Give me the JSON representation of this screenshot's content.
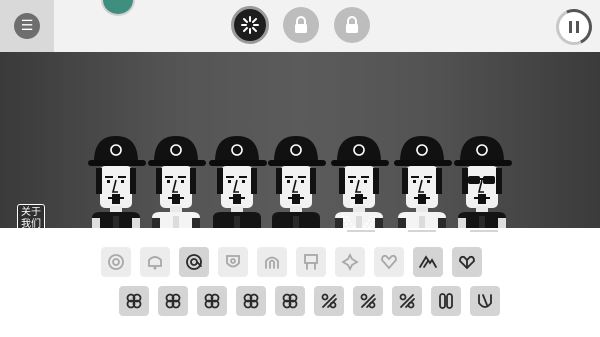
{
  "topbar": {
    "menu_icon": "☰",
    "modes": [
      {
        "name": "mode-1",
        "state": "active",
        "icon": "sparkle-icon"
      },
      {
        "name": "mode-2",
        "state": "locked",
        "icon": "lock-icon"
      },
      {
        "name": "mode-3",
        "state": "locked",
        "icon": "lock-icon"
      }
    ],
    "pause_icon": "pause-icon"
  },
  "stage": {
    "about_line1": "关于",
    "about_line2": "我们",
    "performers": [
      {
        "cap_icon": "swirl",
        "shirt": "vest"
      },
      {
        "cap_icon": "spiral",
        "shirt": "jacket"
      },
      {
        "cap_icon": "dots",
        "shirt": "sleeveless"
      },
      {
        "cap_icon": "loop",
        "shirt": "coat"
      },
      {
        "cap_icon": "flag",
        "shirt": "chains"
      },
      {
        "cap_icon": "spark",
        "shirt": "white-shirt"
      },
      {
        "cap_icon": "heart",
        "shirt": "sunglasses"
      }
    ]
  },
  "palette": {
    "row1": [
      {
        "icon": "target-icon",
        "state": "faint"
      },
      {
        "icon": "bell-icon",
        "state": "faint"
      },
      {
        "icon": "at-sign-icon",
        "state": "solid"
      },
      {
        "icon": "shield-icon",
        "state": "faint"
      },
      {
        "icon": "arch-icon",
        "state": "faint"
      },
      {
        "icon": "flag-icon",
        "state": "faint"
      },
      {
        "icon": "spark-icon",
        "state": "faint"
      },
      {
        "icon": "heart-icon",
        "state": "faint"
      },
      {
        "icon": "mountain-icon",
        "state": "solid"
      },
      {
        "icon": "double-heart-icon",
        "state": "solid"
      }
    ],
    "row2": [
      {
        "icon": "clover-icon",
        "state": "solid"
      },
      {
        "icon": "clover-icon",
        "state": "solid"
      },
      {
        "icon": "clover-icon",
        "state": "solid"
      },
      {
        "icon": "clover-icon",
        "state": "solid"
      },
      {
        "icon": "clover-icon",
        "state": "solid"
      },
      {
        "icon": "percent-icon",
        "state": "solid"
      },
      {
        "icon": "percent-icon",
        "state": "solid"
      },
      {
        "icon": "percent-icon",
        "state": "solid"
      },
      {
        "icon": "zero-icon",
        "state": "solid"
      },
      {
        "icon": "wave-icon",
        "state": "solid"
      }
    ]
  },
  "colors": {
    "accent_dark": "#1d1d1d",
    "tile_solid": "#d4d4d4",
    "tile_faint": "#ececec"
  }
}
